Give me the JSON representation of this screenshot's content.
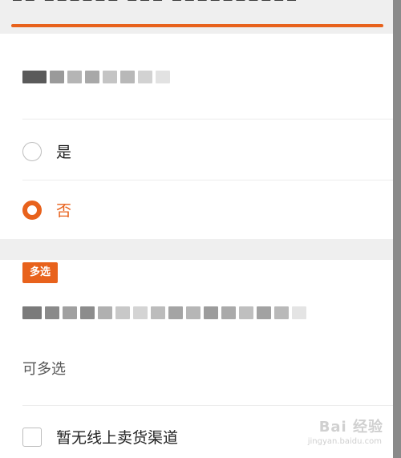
{
  "question_single": {
    "options": [
      {
        "label": "是",
        "selected": false
      },
      {
        "label": "否",
        "selected": true
      }
    ]
  },
  "question_multi": {
    "badge": "多选",
    "hint": "可多选",
    "options": [
      {
        "label": "暂无线上卖货渠道",
        "checked": false
      }
    ]
  },
  "colors": {
    "accent": "#e8621c",
    "section_bg": "#efefef",
    "divider": "#ececec"
  },
  "watermark": {
    "text": "Bai 经验",
    "sub": "jingyan.baidu.com"
  },
  "icons": [
    "radio-unchecked-icon",
    "radio-checked-icon",
    "checkbox-icon"
  ]
}
